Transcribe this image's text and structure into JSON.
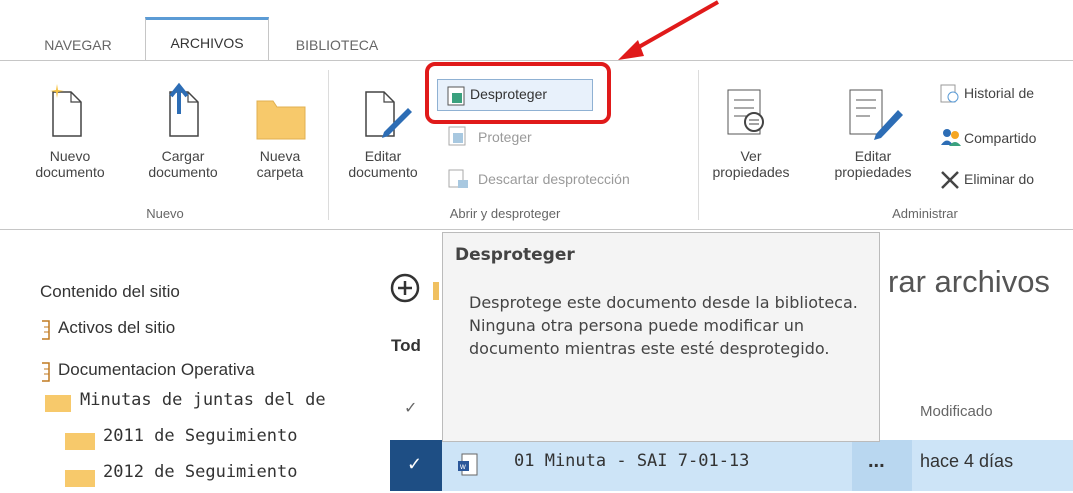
{
  "tabs": [
    {
      "label": "NAVEGAR"
    },
    {
      "label": "ARCHIVOS"
    },
    {
      "label": "BIBLIOTECA"
    }
  ],
  "ribbon": {
    "nuevo": {
      "group_label": "Nuevo",
      "new_doc": "Nuevo\ndocumento",
      "upload": "Cargar\ndocumento",
      "new_folder": "Nueva\ncarpeta"
    },
    "abrir": {
      "group_label": "Abrir y desproteger",
      "edit_doc": "Editar\ndocumento",
      "checkout": "Desproteger",
      "checkin": "Proteger",
      "discard": "Descartar desprotección"
    },
    "administrar": {
      "group_label": "Administrar",
      "view_props": "Ver\npropiedades",
      "edit_props": "Editar\npropiedades",
      "history": "Historial de",
      "shared": "Compartido",
      "delete": "Eliminar do"
    }
  },
  "tooltip": {
    "title": "Desproteger",
    "body": "Desprotege este documento desde la biblioteca. Ninguna otra persona puede modificar un documento mientras este esté desprotegido."
  },
  "nav": {
    "site_contents": "Contenido del sitio",
    "items": [
      {
        "label": "Activos del sitio"
      },
      {
        "label": "Documentacion Operativa"
      },
      {
        "label": "Minutas de juntas del de"
      },
      {
        "label": "2011 de Seguimiento"
      },
      {
        "label": "2012 de Seguimiento"
      }
    ]
  },
  "main": {
    "title_partial": "rar archivos",
    "filter_partial": "Tod",
    "modified_header": "Modificado",
    "row": {
      "name": "01 Minuta - SAI 7-01-13",
      "ellipsis": "...",
      "modified": "hace 4 días"
    }
  }
}
